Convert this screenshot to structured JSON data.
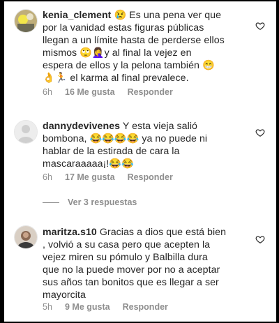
{
  "comments": [
    {
      "username": "kenia_clement",
      "text_lines": [
        "Es una pena ver que",
        "por la vanidad estas figuras públicas",
        "llegan a un límite hasta de perderse ellos",
        "mismos 🙄🤦‍♀️y al final la vejez en",
        "espera de ellos y la pelona también 😁",
        "👌🏃 el karma al final prevalece."
      ],
      "lead_emoji": "😢",
      "time": "6h",
      "likes": "16 Me gusta",
      "reply": "Responder"
    },
    {
      "username": "dannydevivenes",
      "text_lines": [
        "Y esta vieja salió",
        "bombona, 😂😂😂😂 ya no puede  ni",
        "hablar de la estirada de cara la",
        "mascaraaaaa¡!😂😂"
      ],
      "time": "6h",
      "likes": "17 Me gusta",
      "reply": "Responder",
      "view_replies": "Ver 3 respuestas"
    },
    {
      "username": "maritza.s10",
      "text_lines": [
        "Gracias a dios que está bien",
        ", volvió a su casa pero que acepten la",
        "vejez miren su pómulo y Balbilla dura",
        "que no la puede mover por no a aceptar",
        "sus años tan bonitos que es llegar a ser",
        "mayorcita"
      ],
      "time": "5h",
      "likes": "9 Me gusta",
      "reply": "Responder"
    }
  ],
  "colors": {
    "text": "#262626",
    "meta": "#8e8e8e",
    "background": "#ffffff"
  },
  "icons": {
    "heart": "heart-outline-icon"
  }
}
